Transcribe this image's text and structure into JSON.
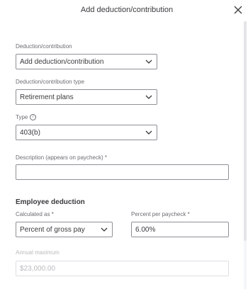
{
  "dialog": {
    "title": "Add deduction/contribution",
    "close_icon": "close-icon"
  },
  "form": {
    "deduction": {
      "label": "Deduction/contribution",
      "value": "Add deduction/contribution"
    },
    "deduction_type": {
      "label": "Deduction/contribution type",
      "value": "Retirement plans"
    },
    "type": {
      "label": "Type",
      "info_icon": "info-icon",
      "info_glyph": "i",
      "value": "403(b)"
    },
    "description": {
      "label": "Description (appears on paycheck) *",
      "value": ""
    }
  },
  "employee_deduction": {
    "heading": "Employee deduction",
    "calculated_as": {
      "label": "Calculated as *",
      "value": "Percent of gross pay"
    },
    "percent_per_paycheck": {
      "label": "Percent per paycheck *",
      "value": "6.00%"
    },
    "annual_maximum": {
      "label": "Annual maximum",
      "value": "$23,000.00"
    }
  },
  "colors": {
    "text": "#393a3d",
    "muted_label": "#6b6c72",
    "border": "#8d9096",
    "disabled": "#b9babd"
  }
}
